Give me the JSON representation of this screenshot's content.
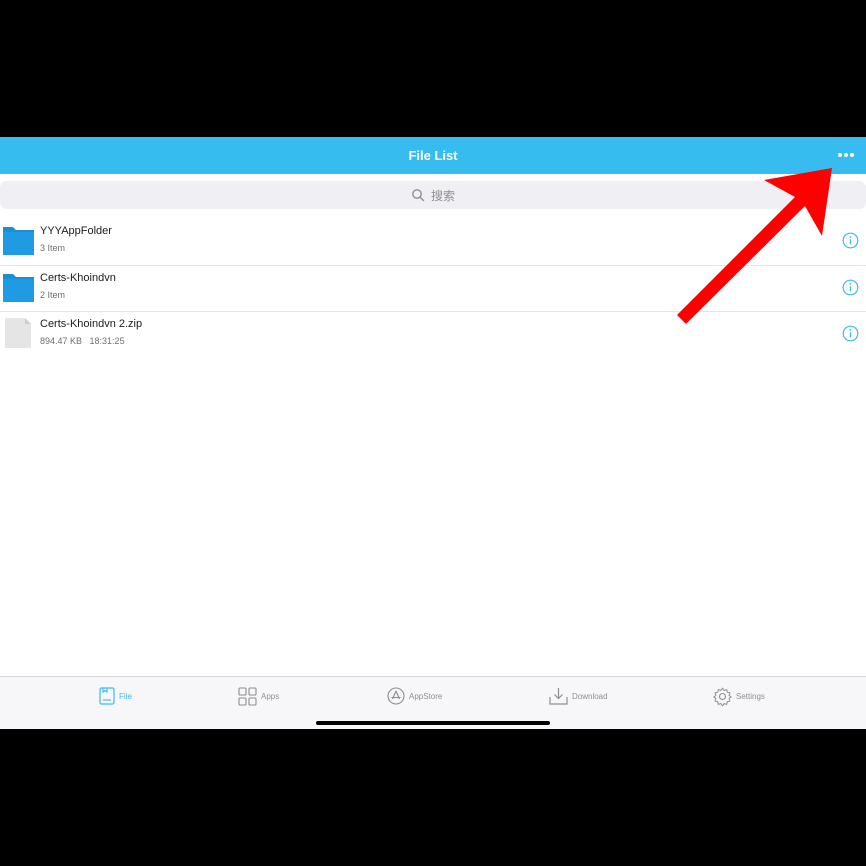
{
  "navbar": {
    "title": "File List",
    "more_icon": "ellipsis-icon"
  },
  "search": {
    "placeholder": "搜索",
    "icon": "search-icon"
  },
  "files": [
    {
      "name": "YYYAppFolder",
      "meta": "3 Item",
      "type": "folder"
    },
    {
      "name": "Certs-Khoindvn",
      "meta": "2 Item",
      "type": "folder"
    },
    {
      "name": "Certs-Khoindvn 2.zip",
      "meta": "894.47 KB   18:31:25",
      "type": "file"
    }
  ],
  "tabbar": {
    "tabs": [
      {
        "label": "File",
        "icon": "file-icon",
        "active": true
      },
      {
        "label": "Apps",
        "icon": "apps-grid-icon",
        "active": false
      },
      {
        "label": "AppStore",
        "icon": "appstore-icon",
        "active": false
      },
      {
        "label": "Download",
        "icon": "download-icon",
        "active": false
      },
      {
        "label": "Settings",
        "icon": "gear-icon",
        "active": false
      }
    ]
  },
  "colors": {
    "accent": "#37bcf0",
    "folder": "#1a8fd8",
    "annotation": "#ff0000"
  }
}
